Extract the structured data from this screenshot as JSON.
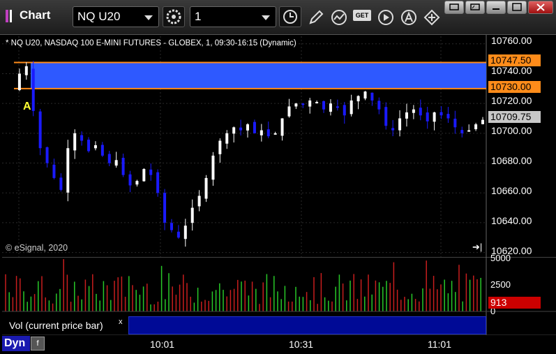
{
  "app": {
    "title": "Chart"
  },
  "toolbar": {
    "symbol": "NQ U20",
    "interval": "1",
    "icons": [
      "link-icon",
      "clock-icon",
      "pencil-icon",
      "study-icon",
      "get-icon",
      "play-icon",
      "alert-icon",
      "move-icon"
    ],
    "get_label": "GET"
  },
  "window_buttons": [
    "restore-icon",
    "maximize-icon",
    "minimize-icon",
    "close-icon"
  ],
  "chart": {
    "title": "* NQ U20, NASDAQ 100 E-MINI FUTURES - GLOBEX, 1, 09:30-16:15 (Dynamic)",
    "copyright": "© eSignal, 2020",
    "marker_label": "A",
    "price_axis": [
      "10760.00",
      "10740.00",
      "10720.00",
      "10700.00",
      "10680.00",
      "10660.00",
      "10640.00",
      "10620.00"
    ],
    "tags": {
      "resistance_top": "10747.50",
      "resistance_bottom": "10730.00",
      "last_price": "10709.75"
    },
    "colors": {
      "zone_fill": "#2e59ff",
      "zone_line": "#ff8c1a",
      "up_candle": "#ffffff",
      "down_candle": "#1a1aff",
      "up_volume": "#28c828",
      "down_volume": "#c81e1e",
      "volume_tag": "#cc0000"
    }
  },
  "volume": {
    "axis": [
      "5000",
      "2500",
      "0"
    ],
    "current": "913",
    "legend_label": "Vol (current price bar)",
    "legend_close": "x"
  },
  "status": {
    "mode": "Dyn",
    "lock_glyph": "f"
  },
  "time_axis": [
    "10:01",
    "10:31",
    "11:01"
  ],
  "chart_data": {
    "type": "candlestick",
    "title": "* NQ U20, NASDAQ 100 E-MINI FUTURES - GLOBEX, 1, 09:30-16:15 (Dynamic)",
    "y_ticks": [
      10620,
      10640,
      10660,
      10680,
      10700,
      10720,
      10740,
      10760
    ],
    "ylim": [
      10617,
      10766
    ],
    "x_ticks": [
      "10:01",
      "10:31",
      "11:01"
    ],
    "zone": {
      "top": 10747.5,
      "bottom": 10730.0
    },
    "last": 10709.75,
    "volume_ylim": [
      0,
      5000
    ],
    "volume_current": 913
  }
}
